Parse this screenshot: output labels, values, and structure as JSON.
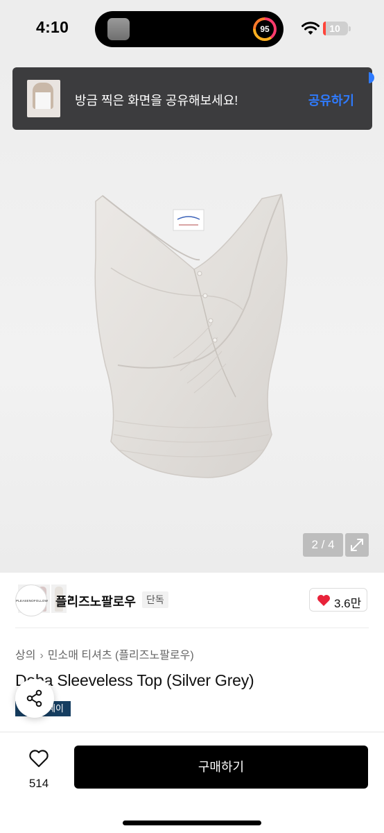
{
  "status_bar": {
    "time": "4:10",
    "activity_ring_value": "95",
    "battery_percent": "10",
    "battery_level": 0.1
  },
  "share_banner": {
    "message": "방금 찍은 화면을 공유해보세요!",
    "action_label": "공유하기",
    "action_color": "#2f7bff"
  },
  "gallery": {
    "current_page": "2",
    "total_pages": "4",
    "page_counter": "2 / 4",
    "thumb_next_icon": "chevron-right-icon",
    "expand_icon": "expand-arrows-icon"
  },
  "brand": {
    "logo_text": "PLEASENOFOLLOW",
    "name": "플리즈노팔로우",
    "badge": "단독",
    "like_icon": "heart-filled-icon",
    "like_count": "3.6만"
  },
  "product": {
    "breadcrumb": [
      "상의",
      "민소매 티셔츠 (플리즈노팔로우)"
    ],
    "title": "Doba Sleeveless Top (Silver Grey)",
    "tag": "쎄이",
    "share_icon": "share-icon"
  },
  "bottom_bar": {
    "wish_icon": "heart-outline-icon",
    "wish_count": "514",
    "buy_label": "구매하기"
  },
  "colors": {
    "buy_button": "#000000",
    "tag_background": "#163e61",
    "heart": "#e8233a"
  }
}
